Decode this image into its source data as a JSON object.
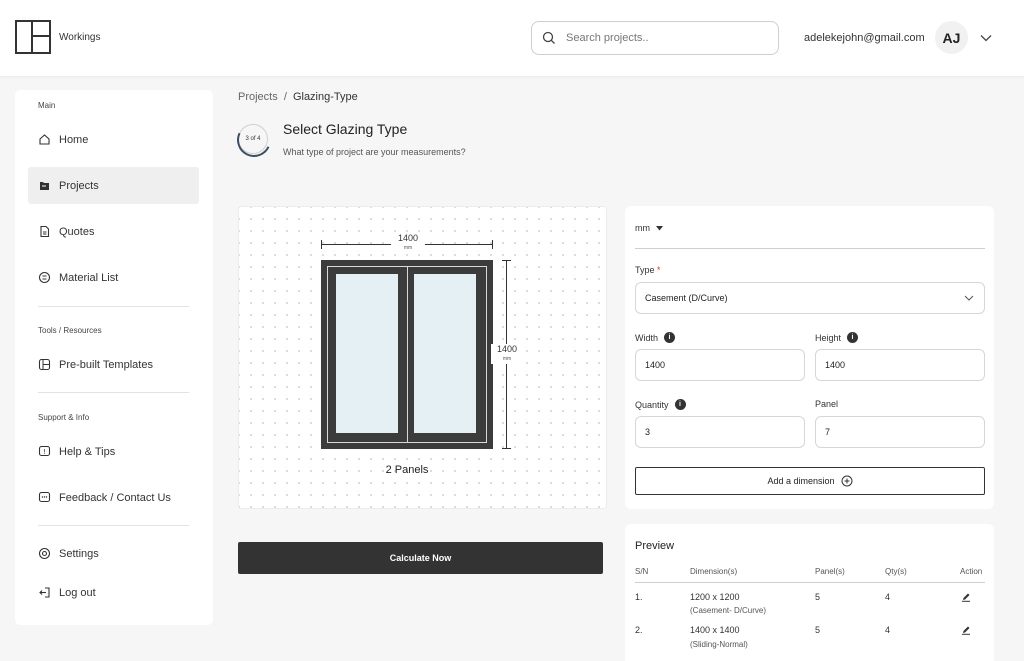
{
  "header": {
    "logo_text": "Workings",
    "search_placeholder": "Search projects..",
    "email": "adelekejohn@gmail.com",
    "avatar_initials": "AJ"
  },
  "sidebar": {
    "main_label": "Main",
    "items_main": [
      "Home",
      "Projects",
      "Quotes",
      "Material List"
    ],
    "tools_label": "Tools / Resources",
    "items_tools": [
      "Pre-built Templates"
    ],
    "support_label": "Support & Info",
    "items_support": [
      "Help & Tips",
      "Feedback / Contact Us"
    ],
    "items_bottom": [
      "Settings",
      "Log out"
    ],
    "active": "Projects"
  },
  "breadcrumb": {
    "root": "Projects",
    "separator": "/",
    "current": "Glazing-Type"
  },
  "step": {
    "label": "3 of 4",
    "current": 3,
    "total": 4
  },
  "title": "Select Glazing Type",
  "subtitle": "What type of project are your measurements?",
  "drawing": {
    "width_value": "1400",
    "height_value": "1400",
    "unit": "mm",
    "panels_label": "2 Panels"
  },
  "calculate_label": "Calculate Now",
  "form": {
    "unit": "mm",
    "type_label": "Type",
    "required_mark": "*",
    "type_value": "Casement (D/Curve)",
    "width_label": "Width",
    "width_value": "1400",
    "height_label": "Height",
    "height_value": "1400",
    "quantity_label": "Quantity",
    "quantity_value": "3",
    "panel_label": "Panel",
    "panel_value": "7",
    "add_dimension_label": "Add a dimension"
  },
  "preview": {
    "title": "Preview",
    "columns": [
      "S/N",
      "Dimension(s)",
      "Panel(s)",
      "Qty(s)",
      "Action"
    ],
    "rows": [
      {
        "sn": "1.",
        "dimension": "1200 x 1200",
        "type": "(Casement- D/Curve)",
        "panels": "5",
        "qty": "4"
      },
      {
        "sn": "2.",
        "dimension": "1400 x 1400",
        "type": "(Sliding-Normal)",
        "panels": "5",
        "qty": "4"
      }
    ]
  },
  "colors": {
    "dark": "#333333",
    "glass": "#e5f0f5",
    "frame": "#3c3c3c",
    "required": "#dd3333"
  }
}
